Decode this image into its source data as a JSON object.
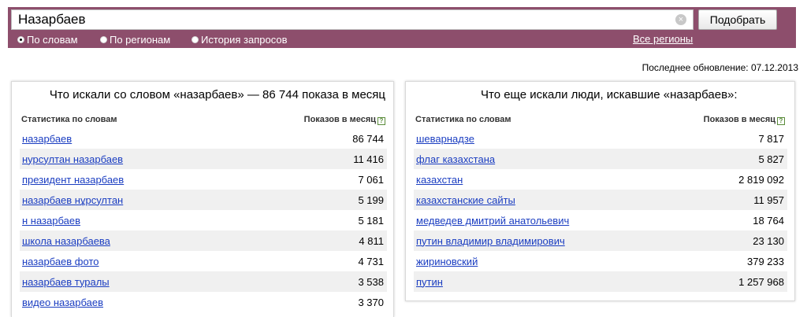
{
  "search": {
    "query": "Назарбаев",
    "submit_label": "Подобрать",
    "modes": [
      "По словам",
      "По регионам",
      "История запросов"
    ],
    "regions_link": "Все регионы"
  },
  "last_update": "Последнее обновление: 07.12.2013",
  "left_panel": {
    "title": "Что искали со словом «назарбаев» — 86 744 показа в месяц",
    "col_words": "Статистика по словам",
    "col_count": "Показов в месяц",
    "rows": [
      {
        "phrase": "назарбаев",
        "count": "86 744"
      },
      {
        "phrase": "нурсултан назарбаев",
        "count": "11 416"
      },
      {
        "phrase": "президент назарбаев",
        "count": "7 061"
      },
      {
        "phrase": "назарбаев нұрсултан",
        "count": "5 199"
      },
      {
        "phrase": "н назарбаев",
        "count": "5 181"
      },
      {
        "phrase": "школа назарбаева",
        "count": "4 811"
      },
      {
        "phrase": "назарбаев фото",
        "count": "4 731"
      },
      {
        "phrase": "назарбаев туралы",
        "count": "3 538"
      },
      {
        "phrase": "видео назарбаев",
        "count": "3 370"
      }
    ]
  },
  "right_panel": {
    "title": "Что еще искали люди, искавшие «назарбаев»:",
    "col_words": "Статистика по словам",
    "col_count": "Показов в месяц",
    "rows": [
      {
        "phrase": "шеварнадзе",
        "count": "7 817"
      },
      {
        "phrase": "флаг казахстана",
        "count": "5 827"
      },
      {
        "phrase": "казахстан",
        "count": "2 819 092"
      },
      {
        "phrase": "казахстанские сайты",
        "count": "11 957"
      },
      {
        "phrase": "медведев дмитрий анатольевич",
        "count": "18 764"
      },
      {
        "phrase": "путин владимир владимирович",
        "count": "23 130"
      },
      {
        "phrase": "жириновский",
        "count": "379 233"
      },
      {
        "phrase": "путин",
        "count": "1 257 968"
      }
    ]
  },
  "help_glyph": "?",
  "clear_glyph": "×",
  "colors": {
    "header": "#8d4e6c",
    "link": "#1a3dc1",
    "stripe": "#f0f0f0"
  }
}
